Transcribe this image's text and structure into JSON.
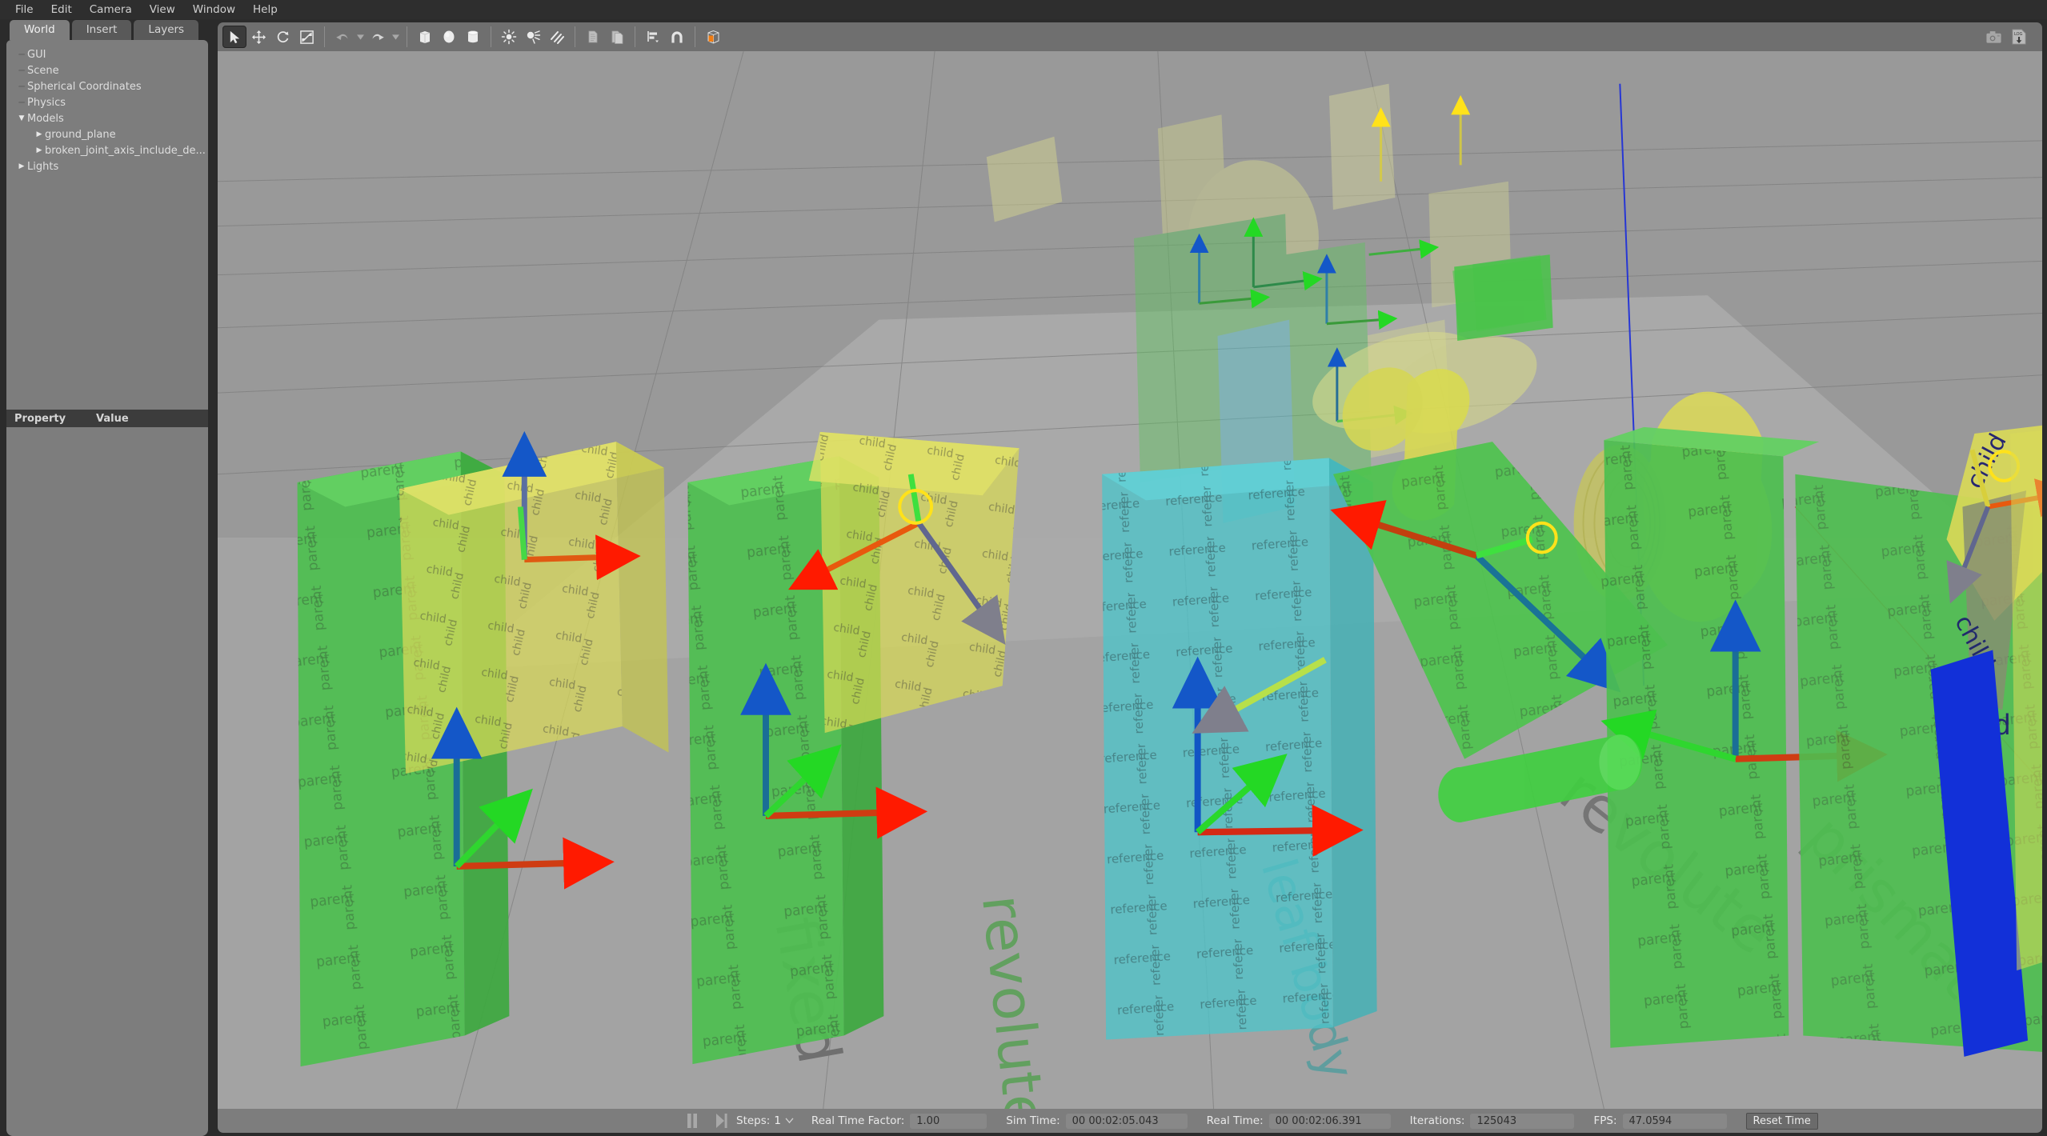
{
  "menubar": {
    "items": [
      {
        "label": "File"
      },
      {
        "label": "Edit"
      },
      {
        "label": "Camera"
      },
      {
        "label": "View"
      },
      {
        "label": "Window"
      },
      {
        "label": "Help"
      }
    ]
  },
  "left_dock": {
    "tabs": [
      {
        "label": "World",
        "active": true
      },
      {
        "label": "Insert",
        "active": false
      },
      {
        "label": "Layers",
        "active": false
      }
    ],
    "tree": [
      {
        "label": "GUI",
        "level": 1,
        "marker": "dash"
      },
      {
        "label": "Scene",
        "level": 1,
        "marker": "dash"
      },
      {
        "label": "Spherical Coordinates",
        "level": 1,
        "marker": "dash"
      },
      {
        "label": "Physics",
        "level": 1,
        "marker": "dash"
      },
      {
        "label": "Models",
        "level": 1,
        "marker": "expanded"
      },
      {
        "label": "ground_plane",
        "level": 2,
        "marker": "collapsed"
      },
      {
        "label": "broken_joint_axis_include_de...",
        "level": 2,
        "marker": "collapsed"
      },
      {
        "label": "Lights",
        "level": 0,
        "marker": "collapsed"
      }
    ],
    "property_table": {
      "columns": [
        "Property",
        "Value"
      ],
      "rows": []
    }
  },
  "toolbar": {
    "groups": [
      {
        "buttons": [
          {
            "name": "select-mode",
            "icon": "cursor-arrow-icon",
            "selected": true,
            "tooltip": "Selection Mode"
          },
          {
            "name": "translate-mode",
            "icon": "translate-icon",
            "selected": false,
            "tooltip": "Translation Mode"
          },
          {
            "name": "rotate-mode",
            "icon": "rotate-icon",
            "selected": false,
            "tooltip": "Rotation Mode"
          },
          {
            "name": "scale-mode",
            "icon": "scale-icon",
            "selected": false,
            "tooltip": "Scale Mode"
          }
        ]
      },
      {
        "buttons": [
          {
            "name": "undo",
            "icon": "undo-icon",
            "selected": false,
            "tooltip": "Undo"
          },
          {
            "name": "undo-history",
            "icon": "chevron-down-icon",
            "selected": false,
            "tooltip": "Undo history"
          },
          {
            "name": "redo",
            "icon": "redo-icon",
            "selected": false,
            "tooltip": "Redo"
          },
          {
            "name": "redo-history",
            "icon": "chevron-down-icon",
            "selected": false,
            "tooltip": "Redo history"
          }
        ]
      },
      {
        "buttons": [
          {
            "name": "insert-box",
            "icon": "box-icon",
            "selected": false,
            "tooltip": "Box"
          },
          {
            "name": "insert-sphere",
            "icon": "sphere-icon",
            "selected": false,
            "tooltip": "Sphere"
          },
          {
            "name": "insert-cylinder",
            "icon": "cylinder-icon",
            "selected": false,
            "tooltip": "Cylinder"
          }
        ]
      },
      {
        "buttons": [
          {
            "name": "insert-point-light",
            "icon": "point-light-icon",
            "selected": false,
            "tooltip": "Point Light"
          },
          {
            "name": "insert-spot-light",
            "icon": "spot-light-icon",
            "selected": false,
            "tooltip": "Spot Light"
          },
          {
            "name": "insert-directional-light",
            "icon": "directional-light-icon",
            "selected": false,
            "tooltip": "Directional Light"
          }
        ]
      },
      {
        "buttons": [
          {
            "name": "copy",
            "icon": "copy-icon",
            "selected": false,
            "tooltip": "Copy"
          },
          {
            "name": "paste",
            "icon": "paste-icon",
            "selected": false,
            "tooltip": "Paste"
          }
        ]
      },
      {
        "buttons": [
          {
            "name": "align",
            "icon": "align-icon",
            "selected": false,
            "tooltip": "Align"
          },
          {
            "name": "snap",
            "icon": "snap-magnet-icon",
            "selected": false,
            "tooltip": "Snap"
          }
        ]
      },
      {
        "buttons": [
          {
            "name": "change-view",
            "icon": "view-cube-icon",
            "selected": false,
            "tooltip": "Change the view angle"
          }
        ]
      }
    ],
    "right_buttons": [
      {
        "name": "screenshot",
        "icon": "camera-icon",
        "tooltip": "Take a screenshot"
      },
      {
        "name": "save-log",
        "icon": "log-download-icon",
        "label": "LOG",
        "tooltip": "Log data"
      }
    ]
  },
  "statusbar": {
    "pause_icon": "pause-icon",
    "step_icon": "step-forward-icon",
    "steps_label": "Steps:",
    "steps_value": "1",
    "steps_caret": "chevron-down-icon",
    "real_time_factor_label": "Real Time Factor:",
    "real_time_factor_value": "1.00",
    "sim_time_label": "Sim Time:",
    "sim_time_value": "00 00:02:05.043",
    "real_time_label": "Real Time:",
    "real_time_value": "00 00:02:06.391",
    "iterations_label": "Iterations:",
    "iterations_value": "125043",
    "fps_label": "FPS:",
    "fps_value": "47.0594",
    "reset_time_label": "Reset Time"
  },
  "scene": {
    "ground_labels": [
      {
        "text": "fixed"
      },
      {
        "text": "revolute"
      },
      {
        "text": "revolute"
      },
      {
        "text": "prismatic"
      }
    ],
    "body_labels": {
      "parent": "parent",
      "child": "child",
      "reference": "reference",
      "leaf_body": "leaf body"
    },
    "colors": {
      "parent_body": "#4fbf52",
      "child_body": "#d9d94f",
      "reference_body": "#4fc4c9",
      "axis_x": "#ff1a00",
      "axis_y": "#26d926",
      "axis_z": "#1457c8",
      "axis_joint": "#ffe21a",
      "sky": "#999999",
      "ground": "#a3a3a3"
    }
  }
}
